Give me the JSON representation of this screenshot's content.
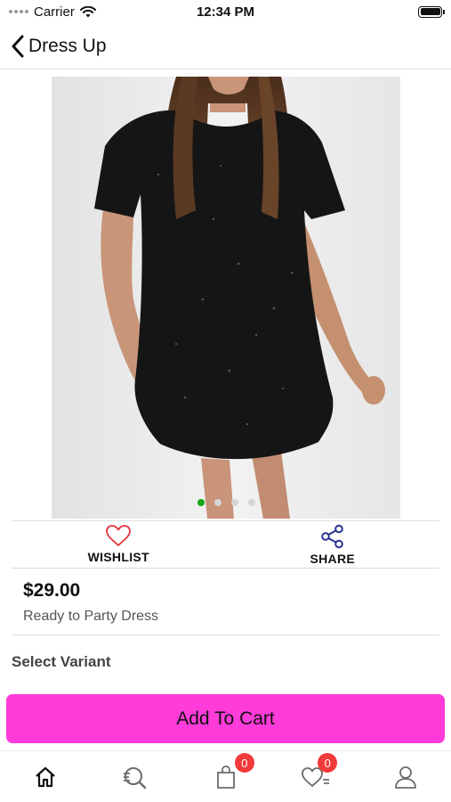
{
  "status_bar": {
    "carrier": "Carrier",
    "time": "12:34 PM"
  },
  "nav": {
    "title": "Dress Up",
    "back_icon": "chevron-left-icon"
  },
  "product": {
    "image_icon": "product-photo",
    "carousel": {
      "total": 4,
      "active_index": 0
    },
    "price": "$29.00",
    "name": "Ready to Party Dress"
  },
  "actions": {
    "wishlist": {
      "label": "WISHLIST",
      "icon": "heart-icon",
      "color": "#e0343a"
    },
    "share": {
      "label": "SHARE",
      "icon": "share-icon",
      "color": "#27338f"
    }
  },
  "variant": {
    "title": "Select Variant"
  },
  "cart_button": {
    "label": "Add To Cart",
    "color": "#ff3bd9"
  },
  "tab_bar": {
    "tabs": [
      {
        "name": "home",
        "icon": "home-icon"
      },
      {
        "name": "search",
        "icon": "search-list-icon"
      },
      {
        "name": "cart",
        "icon": "shopping-bag-icon",
        "badge": "0"
      },
      {
        "name": "wishlist",
        "icon": "heart-list-icon",
        "badge": "0"
      },
      {
        "name": "profile",
        "icon": "user-icon"
      }
    ],
    "badge_color": "#f23a3a"
  }
}
